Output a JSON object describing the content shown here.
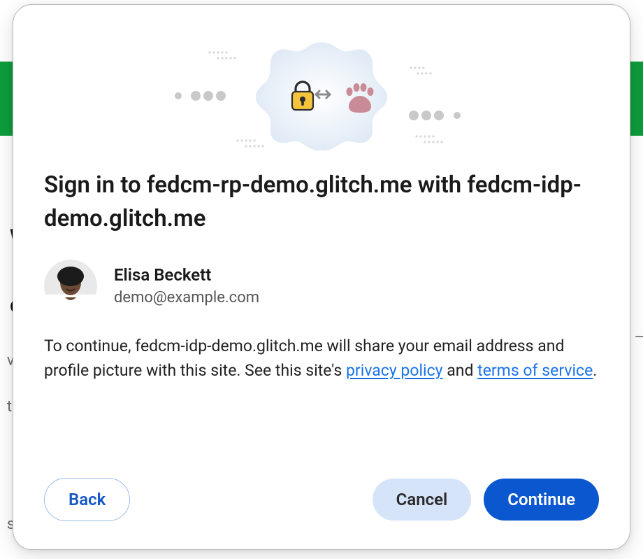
{
  "background": {
    "heading_line1": "We",
    "heading_line2": "o",
    "left_mid_1": "vo",
    "left_mid_2": "t",
    "left_bottom_1": "se"
  },
  "dialog": {
    "title": "Sign in to fedcm-rp-demo.glitch.me with fedcm-idp-demo.glitch.me",
    "account": {
      "name": "Elisa Beckett",
      "email": "demo@example.com"
    },
    "disclosure": {
      "pre": "To continue, fedcm-idp-demo.glitch.me will share your email address and profile picture with this site. See this site's ",
      "privacy_label": "privacy policy",
      "middle": " and ",
      "tos_label": "terms of service",
      "post": "."
    },
    "buttons": {
      "back": "Back",
      "cancel": "Cancel",
      "continue": "Continue"
    }
  }
}
